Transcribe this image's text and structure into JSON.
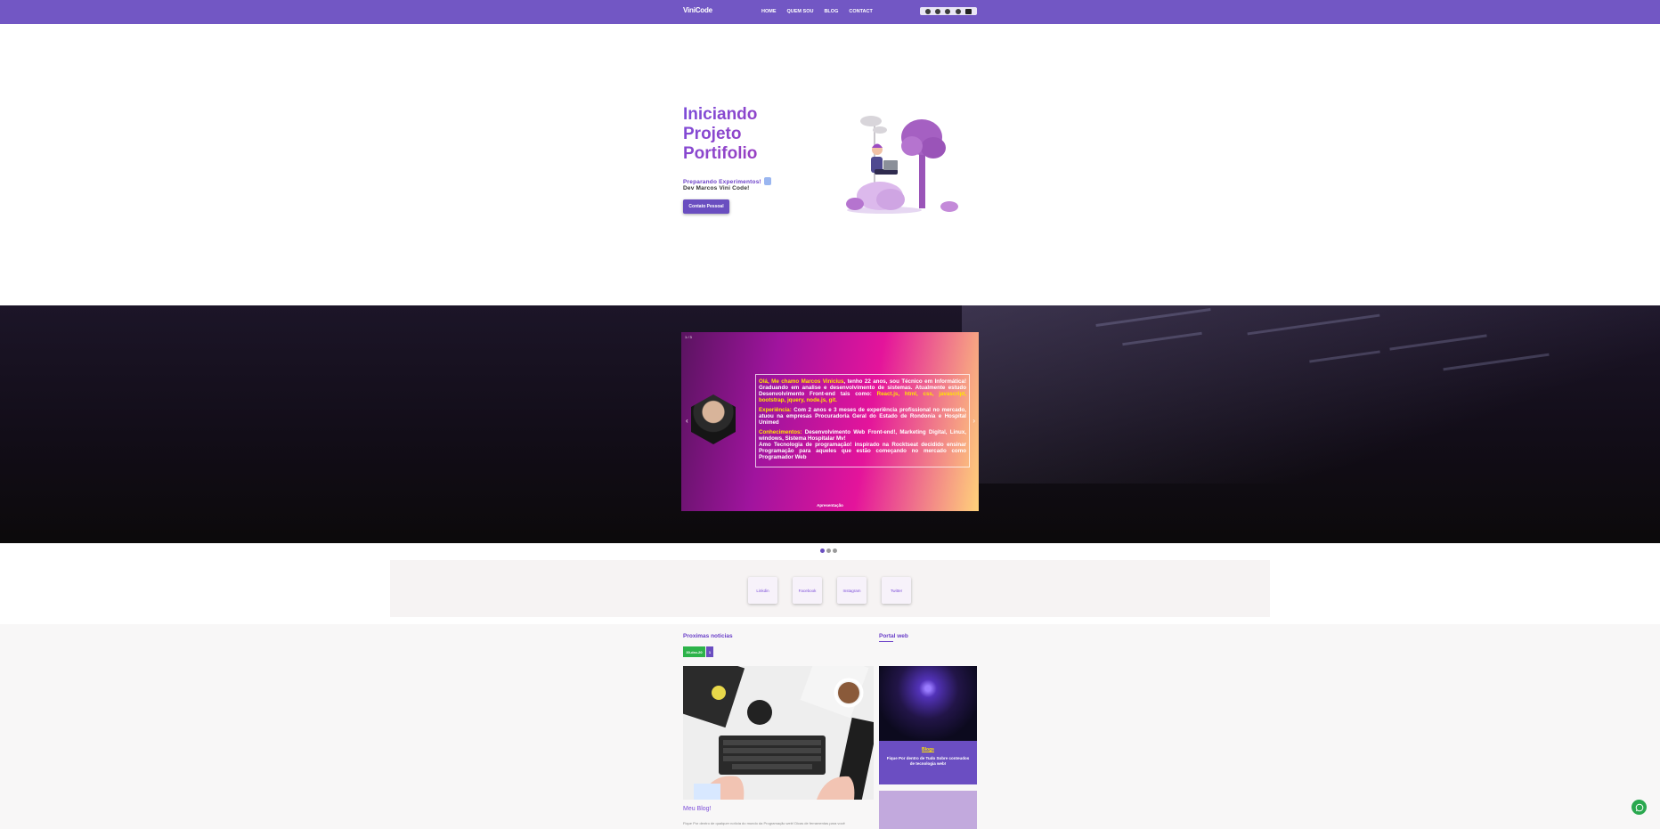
{
  "navbar": {
    "brand": "ViniCode",
    "links": [
      "HOME",
      "QUEM SOU",
      "BLOG",
      "CONTACT"
    ],
    "social_icons": [
      "tiktok-icon",
      "instagram-icon",
      "facebook-icon",
      "linkedin-icon",
      "youtube-icon"
    ]
  },
  "hero": {
    "title": "Iniciando Projeto Portifolio",
    "subtitle": "Preparando Experimentos!",
    "subtitle2": "Dev Marcos Vini Code!",
    "button": "Contato Pessoal"
  },
  "carousel": {
    "counter": "1 / 3",
    "caption": "Apresentação",
    "bio_intro_highlight": "Olá, Me chamo Marcos Vinicius",
    "bio_intro_text": ", tenho 22 anos, sou Técnico em Informática! Graduando em analise e desenvolvimento de sistemas. Atualmente estudo Desenvolvimento Front-end tais como: ",
    "bio_intro_tech": "React.js, html, css, javascript, bootstrap, jquery, node.js, git.",
    "experience_label": "Experiência:",
    "experience_text": " Com 2 anos e 3 meses de experiência profissional no mercado, atuou na empresas Procuradoria Geral do Estado de Rondonia e Hospital Unimed",
    "knowledge_label": "Conhecimentos:",
    "knowledge_text": " Desenvolvimento Web Front-end!, Marketing Digital, Linux, windows, Sistema Hospitalar Mv!",
    "passion_text": "Amo Tecnologia de programação! inspirado na Rocktseat decidido ensinar Programação para aqueles que estão começando no mercado como Programador Web",
    "dots": 3,
    "active_dot": 0
  },
  "social_section": {
    "cards": [
      "Linkdin",
      "Facebook",
      "Instagram",
      "Twitter"
    ]
  },
  "blog": {
    "heading": "Proximas noticias",
    "date": "30-dez-20",
    "badge_num": "1",
    "post_title": "Meu Blog!",
    "post_text": "Fique Por dentro de qualquer notícia do mundo da Programação web! Dicas de ferramentas para você",
    "portal_heading": "Portal web",
    "portal_label": "Blogs",
    "portal_desc": "Fique Por dentro de Tudo Sobre conteudos de tecnologia web!"
  },
  "colors": {
    "primary": "#7257c4",
    "accent_yellow": "#ffe600",
    "whatsapp": "#2aa84f"
  }
}
